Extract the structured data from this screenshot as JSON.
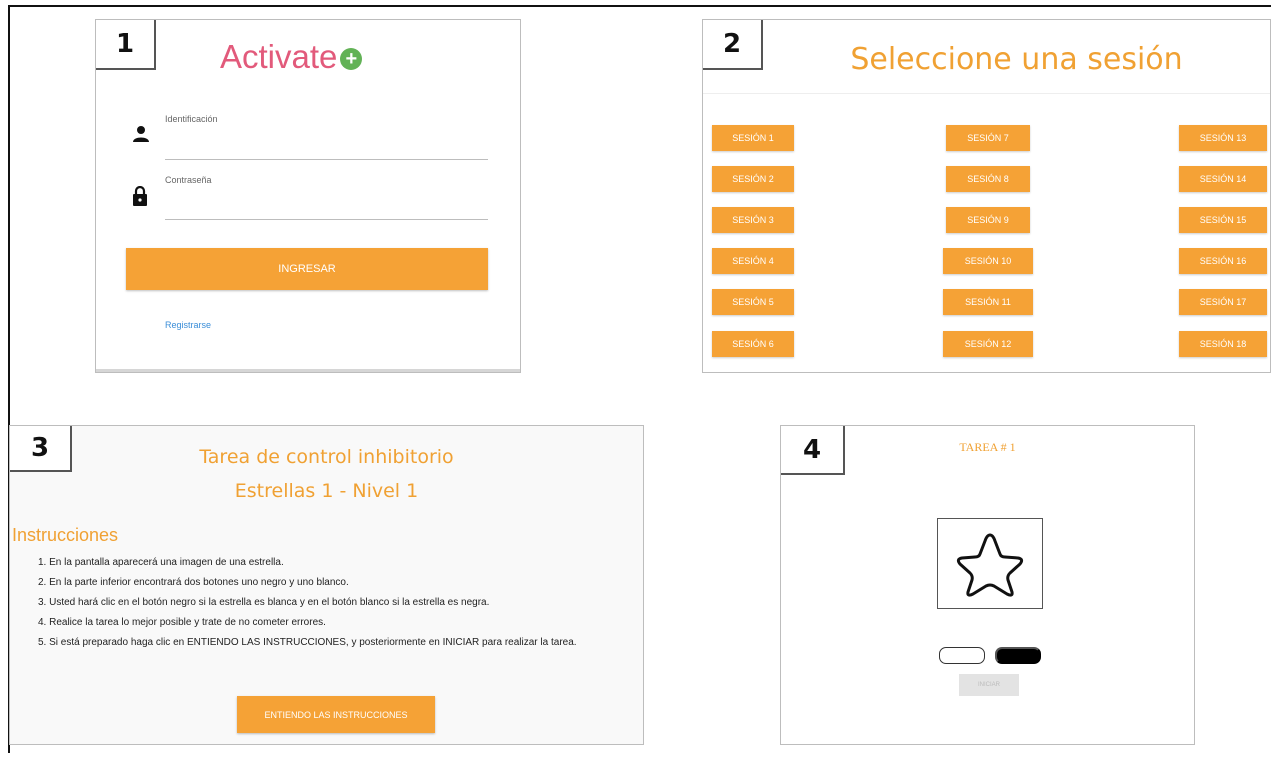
{
  "panel1": {
    "number": "1",
    "logo_text": "Activate",
    "logo_plus": "+",
    "id_label": "Identificación",
    "password_label": "Contraseña",
    "login_button": "INGRESAR",
    "register_link": "Registrarse",
    "icons": [
      "user-icon",
      "lock-icon",
      "plus-circle-icon"
    ]
  },
  "panel2": {
    "number": "2",
    "title": "Seleccione una sesión",
    "sessions": [
      "SESIÓN 1",
      "SESIÓN 2",
      "SESIÓN 3",
      "SESIÓN 4",
      "SESIÓN 5",
      "SESIÓN 6",
      "SESIÓN 7",
      "SESIÓN 8",
      "SESIÓN 9",
      "SESIÓN 10",
      "SESIÓN 11",
      "SESIÓN 12",
      "SESIÓN 13",
      "SESIÓN 14",
      "SESIÓN 15",
      "SESIÓN 16",
      "SESIÓN 17",
      "SESIÓN 18"
    ]
  },
  "panel3": {
    "number": "3",
    "title": "Tarea de control inhibitorio",
    "subtitle": "Estrellas 1 - Nivel 1",
    "instructions_heading": "Instrucciones",
    "instructions": [
      "1. En la pantalla aparecerá una imagen de una estrella.",
      "2. En la parte inferior encontrará dos botones uno negro y uno blanco.",
      "3. Usted hará clic en el botón negro si la estrella es blanca y en el botón blanco si la estrella es negra.",
      "4. Realice la tarea lo mejor posible y trate de no cometer errores.",
      "5. Si está preparado haga clic en ENTIENDO LAS INSTRUCCIONES, y posteriormente en INICIAR para realizar la tarea."
    ],
    "confirm_button": "ENTIENDO LAS INSTRUCCIONES"
  },
  "panel4": {
    "number": "4",
    "task_title": "TAREA # 1",
    "start_button": "INICIAR",
    "icons": [
      "star-outline-icon"
    ]
  },
  "colors": {
    "accent_orange": "#f5a236",
    "logo_pink": "#e25a7b",
    "logo_green": "#62b256",
    "link_blue": "#3b8ed8"
  }
}
